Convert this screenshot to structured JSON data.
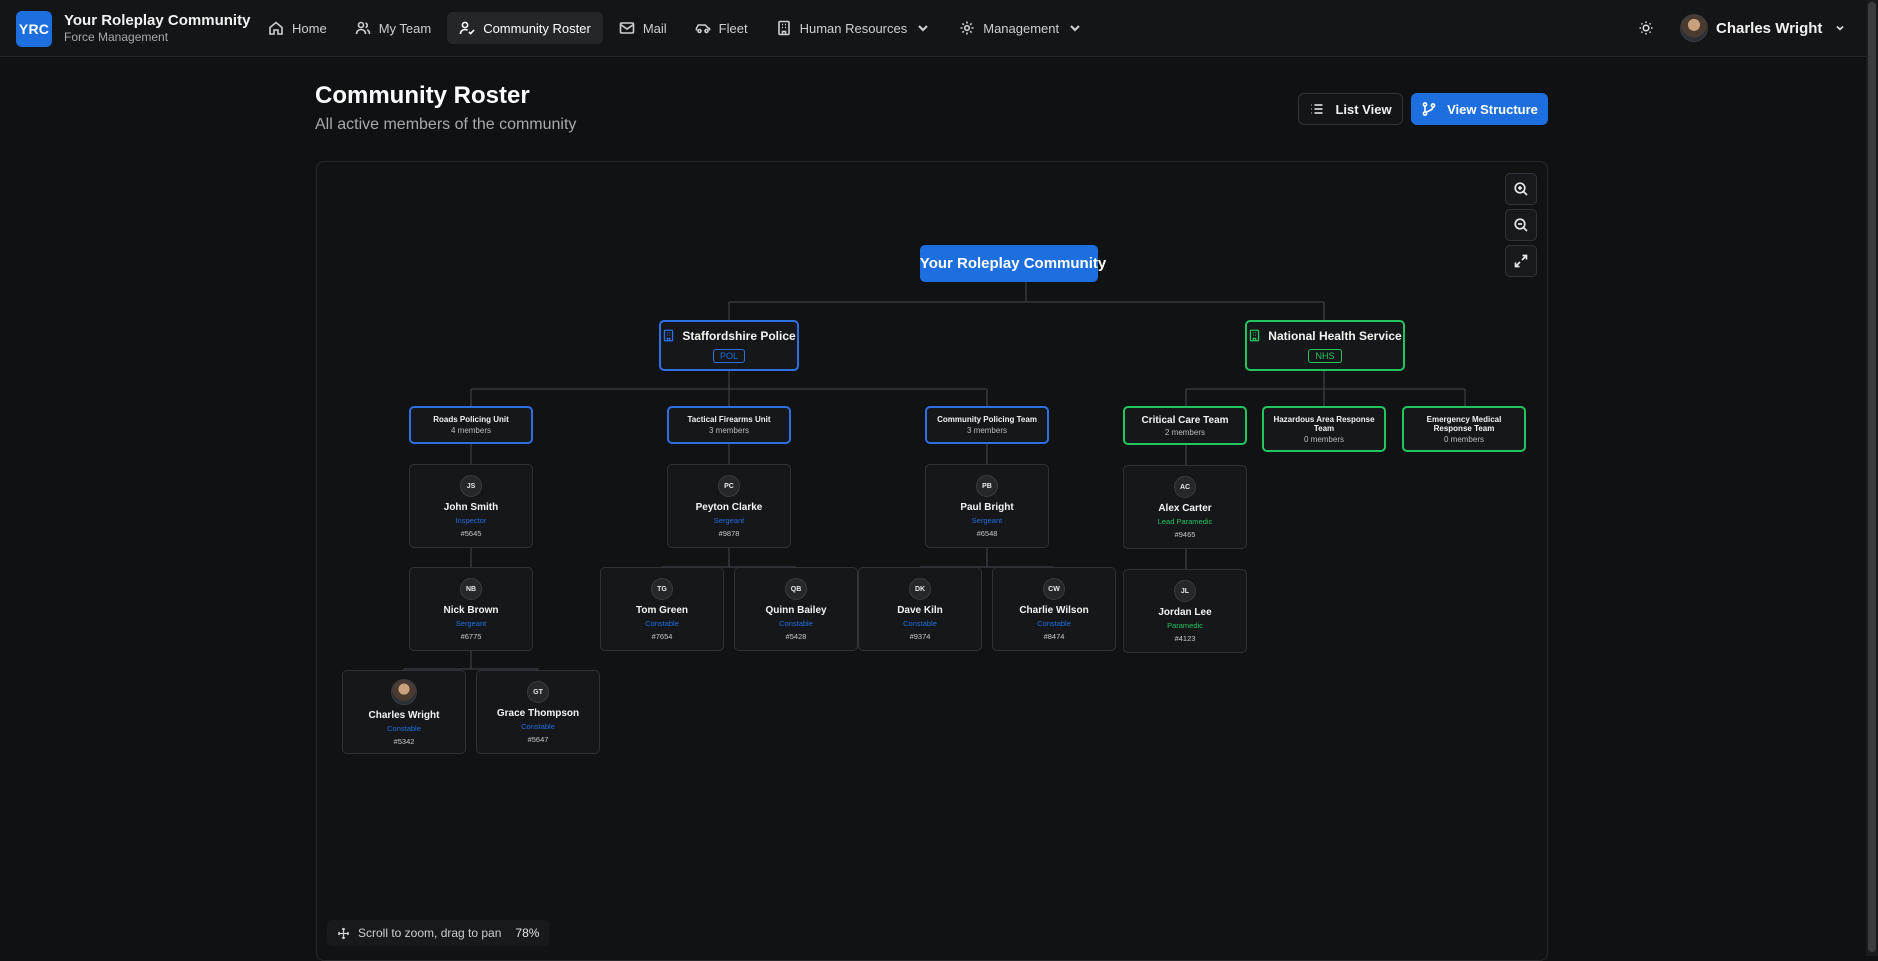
{
  "brand": {
    "logo": "YRC",
    "title": "Your Roleplay Community",
    "subtitle": "Force Management"
  },
  "nav": {
    "home": "Home",
    "my_team": "My Team",
    "community_roster": "Community Roster",
    "mail": "Mail",
    "fleet": "Fleet",
    "human_resources": "Human Resources",
    "management": "Management"
  },
  "user": {
    "name": "Charles Wright"
  },
  "page": {
    "title": "Community Roster",
    "subtitle": "All active members of the community"
  },
  "actions": {
    "list_view": "List View",
    "view_structure": "View Structure"
  },
  "colors": {
    "accent": "#1d6fe0",
    "police": "#2f6fe4",
    "nhs": "#22c55e"
  },
  "org": {
    "root": "Your Roleplay Community",
    "police": {
      "name": "Staffordshire Police",
      "code": "POL"
    },
    "nhs": {
      "name": "National Health Service",
      "code": "NHS"
    },
    "units": {
      "roads": {
        "name": "Roads Policing Unit",
        "count": "4 members"
      },
      "tactical": {
        "name": "Tactical Firearms Unit",
        "count": "3 members"
      },
      "community": {
        "name": "Community Policing Team",
        "count": "3 members"
      },
      "critical": {
        "name": "Critical Care Team",
        "count": "2 members"
      },
      "hazardous": {
        "name": "Hazardous Area Response Team",
        "count": "0 members"
      },
      "emergency": {
        "name": "Emergency Medical Response Team",
        "count": "0 members"
      }
    },
    "members": {
      "js": {
        "initials": "JS",
        "name": "John Smith",
        "rank": "Inspector",
        "badge": "#5645"
      },
      "nb": {
        "initials": "NB",
        "name": "Nick Brown",
        "rank": "Sergeant",
        "badge": "#6775"
      },
      "cw1": {
        "initials": "",
        "name": "Charles Wright",
        "rank": "Constable",
        "badge": "#5342"
      },
      "gt": {
        "initials": "GT",
        "name": "Grace Thompson",
        "rank": "Constable",
        "badge": "#5647"
      },
      "pc": {
        "initials": "PC",
        "name": "Peyton Clarke",
        "rank": "Sergeant",
        "badge": "#9878"
      },
      "tg": {
        "initials": "TG",
        "name": "Tom Green",
        "rank": "Constable",
        "badge": "#7654"
      },
      "qb": {
        "initials": "QB",
        "name": "Quinn Bailey",
        "rank": "Constable",
        "badge": "#5428"
      },
      "pb": {
        "initials": "PB",
        "name": "Paul Bright",
        "rank": "Sergeant",
        "badge": "#6548"
      },
      "dk": {
        "initials": "DK",
        "name": "Dave Kiln",
        "rank": "Constable",
        "badge": "#9374"
      },
      "cw2": {
        "initials": "CW",
        "name": "Charlie Wilson",
        "rank": "Constable",
        "badge": "#8474"
      },
      "ac": {
        "initials": "AC",
        "name": "Alex Carter",
        "rank": "Lead Paramedic",
        "badge": "#9465"
      },
      "jl": {
        "initials": "JL",
        "name": "Jordan Lee",
        "rank": "Paramedic",
        "badge": "#4123"
      }
    }
  },
  "canvas": {
    "hint": "Scroll to zoom, drag to pan",
    "zoom": "78%"
  }
}
